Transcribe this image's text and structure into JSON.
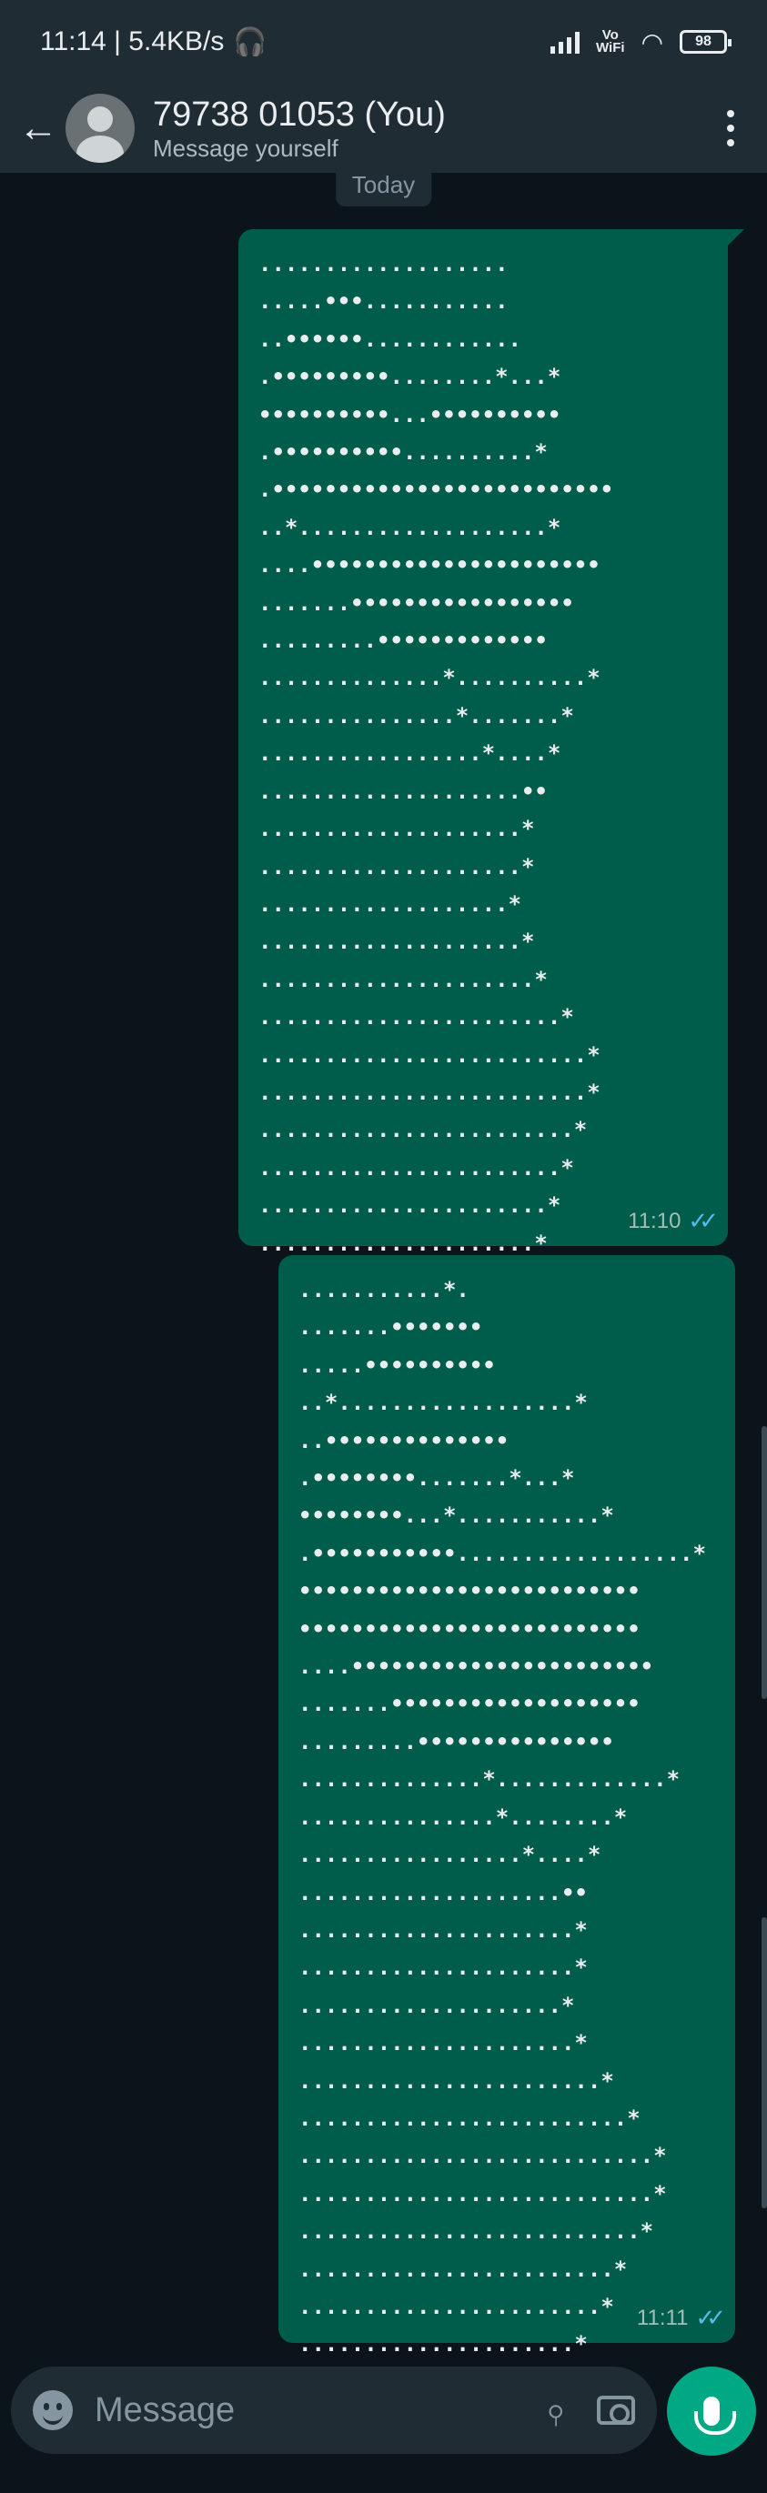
{
  "status_bar": {
    "time_speed": "11:14 | 5.4KB/s",
    "network_label": "Vo\nWiFi",
    "battery": "98"
  },
  "header": {
    "title": "79738 01053 (You)",
    "subtitle": "Message yourself"
  },
  "chat": {
    "date_chip": "Today",
    "messages": [
      {
        "art": "...................\n.....•••...........\n..••••••............\n.•••••••••........*...*\n••••••••••...••••••••••\n.••••••••••..........*\n.••••••••••••••••••••••••••\n..*...................*\n....••••••••••••••••••••••\n.......•••••••••••••••••\n.........•••••••••••••\n..............*..........*\n...............*.......*\n.................*....*\n....................••\n....................*\n....................*\n...................*\n....................*\n.....................*\n.......................*\n.........................*\n.........................*\n........................*\n.......................*\n......................*\n.....................*",
        "time": "11:10"
      },
      {
        "art": "...........*.\n.......•••••••\n.....••••••••••\n..*..................*\n..••••••••••••••\n.••••••••.......*...*\n••••••••...*...........*\n.•••••••••••..................*\n••••••••••••••••••••••••••\n••••••••••••••••••••••••••\n....•••••••••••••••••••••••\n.......•••••••••••••••••••\n.........•••••••••••••••\n..............*.............*\n...............*........*\n.................*....*\n....................••\n.....................*\n.....................*\n....................*\n.....................*\n.......................*\n.........................*\n...........................*\n...........................*\n..........................*\n........................*\n.......................*\n.....................*",
        "time": "11:11"
      }
    ]
  },
  "composer": {
    "placeholder": "Message"
  },
  "colors": {
    "bubble_out": "#005c4b",
    "background": "#0b141a",
    "accent": "#00a884",
    "read_ticks": "#53bdeb"
  },
  "icons": [
    "back-arrow-icon",
    "avatar-icon",
    "more-options-icon",
    "emoji-icon",
    "attach-icon",
    "camera-icon",
    "mic-icon"
  ]
}
